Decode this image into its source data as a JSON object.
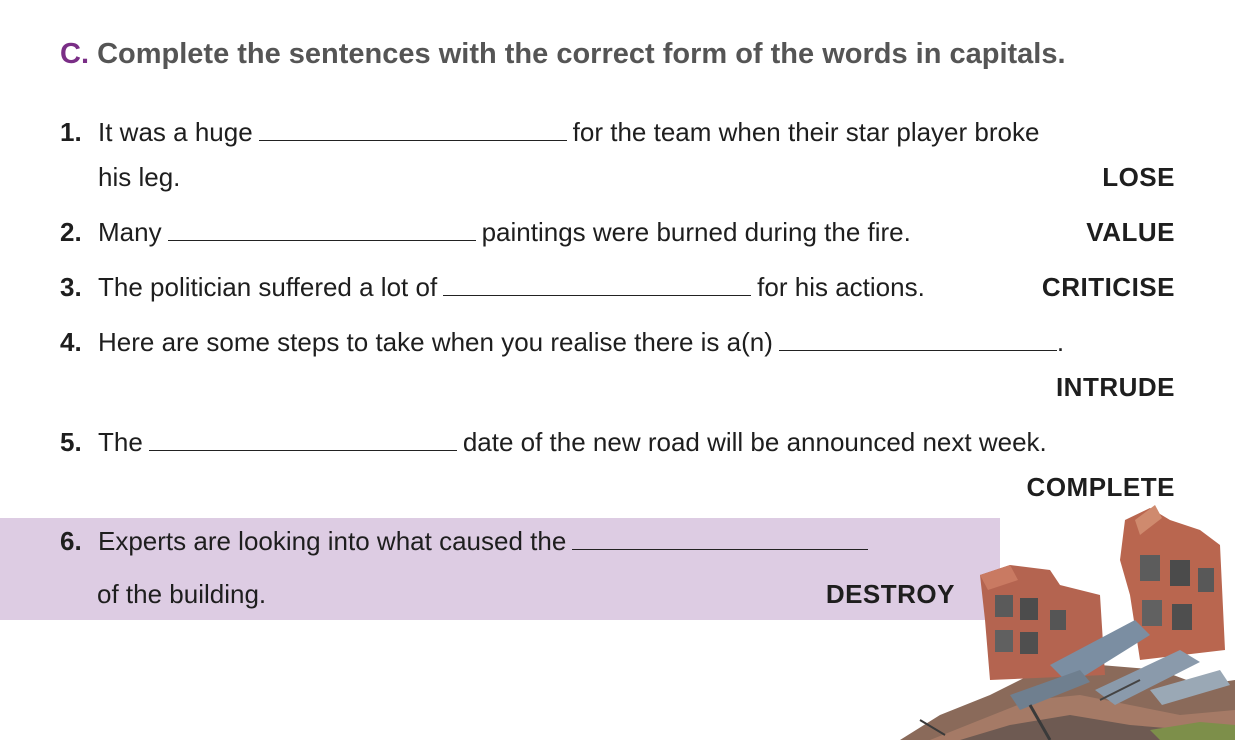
{
  "heading": {
    "letter": "C.",
    "text": "Complete the sentences with the correct form of the words in capitals."
  },
  "items": [
    {
      "num": "1.",
      "before": "It was a huge",
      "after": "for the team when their star player broke",
      "cont": "his leg.",
      "word": "LOSE"
    },
    {
      "num": "2.",
      "before": "Many",
      "after": "paintings were burned during the fire.",
      "word": "VALUE"
    },
    {
      "num": "3.",
      "before": "The politician suffered a lot of",
      "after": "for his actions.",
      "word": "CRITICISE"
    },
    {
      "num": "4.",
      "before": "Here are some steps to take when you realise there is a(n)",
      "after": ".",
      "word": "INTRUDE"
    },
    {
      "num": "5.",
      "before": "The",
      "after": "date of the new road will be announced next week.",
      "word": "COMPLETE"
    },
    {
      "num": "6.",
      "before": "Experts are looking into what caused the",
      "after": "",
      "cont": "of the building.",
      "word": "DESTROY"
    }
  ],
  "illustration": {
    "icon": "collapsed-building-icon"
  }
}
